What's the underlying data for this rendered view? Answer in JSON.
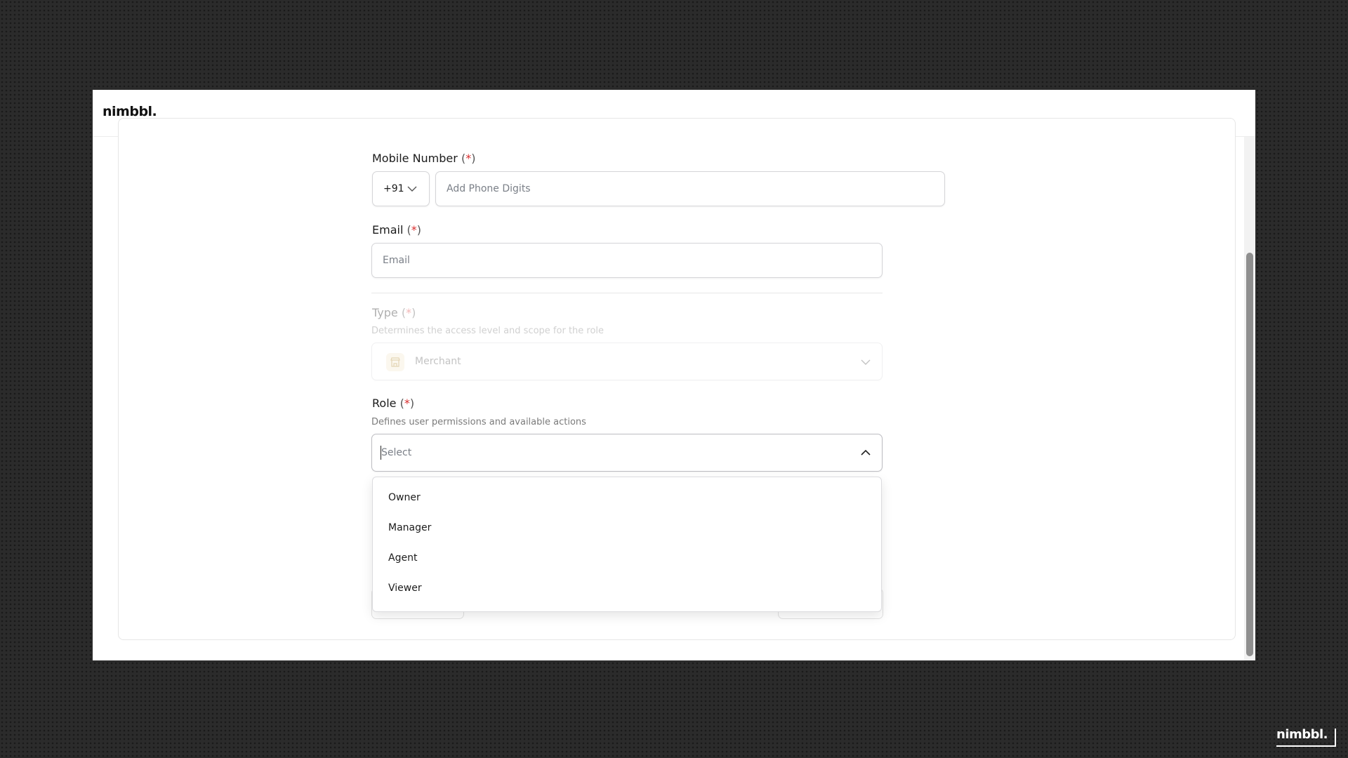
{
  "brand": {
    "name": "nimbbl."
  },
  "form": {
    "mobile": {
      "label": "Mobile Number",
      "required_mark": "(*)",
      "country_code": "+91",
      "placeholder": "Add Phone Digits"
    },
    "email": {
      "label": "Email",
      "required_mark": "(*)",
      "placeholder": "Email"
    },
    "type": {
      "label": "Type",
      "required_mark": "(*)",
      "helper": "Determines the access level and scope for the role",
      "value": "Merchant",
      "icon": "store-icon"
    },
    "role": {
      "label": "Role",
      "required_mark": "(*)",
      "helper": "Defines user permissions and available actions",
      "placeholder": "Select",
      "options": [
        "Owner",
        "Manager",
        "Agent",
        "Viewer"
      ]
    }
  },
  "colors": {
    "required_star": "#d92d2d",
    "background": "#2b2b2b",
    "scrollbar_thumb": "#8f8f8f"
  }
}
